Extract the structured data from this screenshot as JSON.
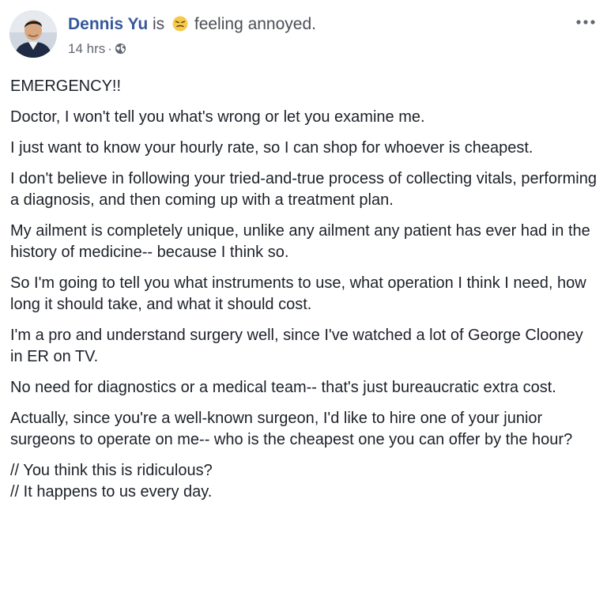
{
  "post": {
    "author": "Dennis Yu",
    "is_text": "is",
    "feeling_emoji": "annoyed-face-icon",
    "feeling_text": "feeling annoyed.",
    "time": "14 hrs",
    "separator": "·",
    "privacy_icon": "globe-icon",
    "more_icon": "more-options-icon",
    "paragraphs": [
      "EMERGENCY!!",
      "Doctor, I won't tell you what's wrong or let you examine me.",
      "I just want to know your hourly rate, so I can shop for whoever is cheapest.",
      "I don't believe in following your tried-and-true process of collecting vitals, performing a diagnosis, and then coming up with a treatment plan.",
      "My ailment is completely unique, unlike any ailment any patient has ever had in the history of medicine-- because I think so.",
      "So I'm going to tell you what instruments to use, what operation I think I need, how long it should take, and what it should cost.",
      "I'm a pro and understand surgery well, since I've watched a lot of George Clooney in ER on TV.",
      "No need for diagnostics or a medical team-- that's just bureaucratic extra cost.",
      "Actually, since you're a well-known surgeon, I'd like to hire one of your junior surgeons to operate on me-- who is the cheapest one you can offer by the hour?",
      "// You think this is ridiculous?\n// It happens to us every day."
    ]
  },
  "colors": {
    "author": "#365899",
    "text": "#1d2129",
    "meta": "#616770"
  }
}
